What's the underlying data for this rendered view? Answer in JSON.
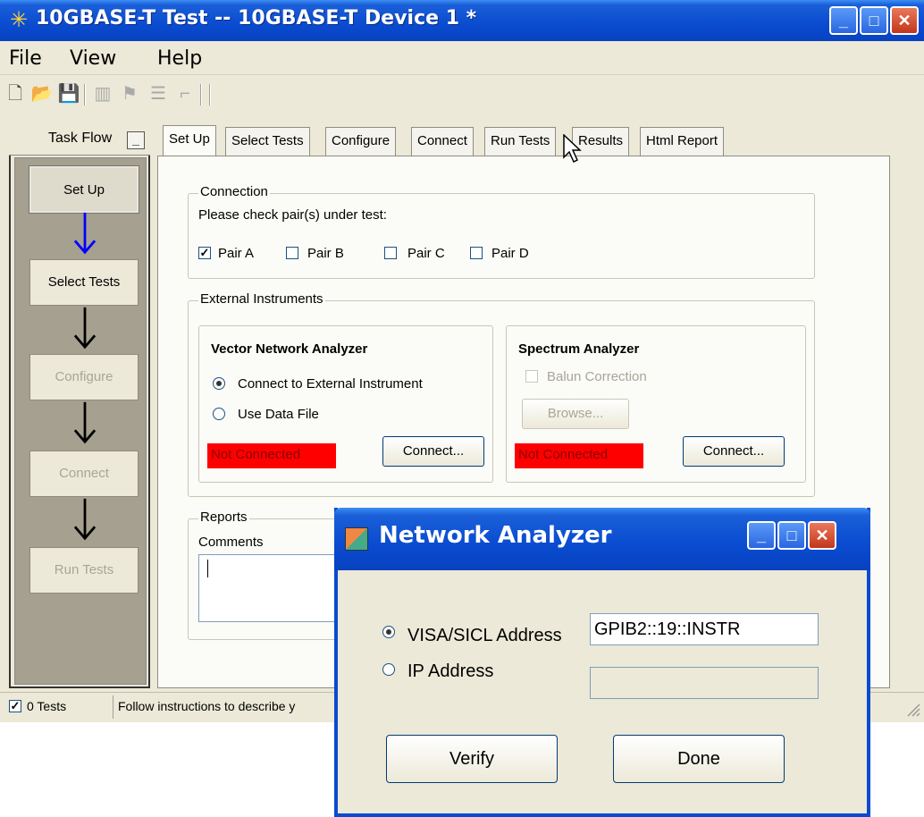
{
  "window": {
    "title": "10GBASE-T Test -- 10GBASE-T Device 1 *"
  },
  "menu": [
    "File",
    "View",
    "Help"
  ],
  "toolbar_icons": [
    "new-file-icon",
    "open-folder-icon",
    "save-icon",
    "chart-icon",
    "flag-icon",
    "list-icon",
    "bracket-icon"
  ],
  "task_flow": {
    "title": "Task Flow",
    "steps": [
      {
        "label": "Set Up",
        "state": "active"
      },
      {
        "label": "Select Tests",
        "state": "enabled"
      },
      {
        "label": "Configure",
        "state": "disabled"
      },
      {
        "label": "Connect",
        "state": "disabled"
      },
      {
        "label": "Run Tests",
        "state": "disabled"
      }
    ]
  },
  "tabs": [
    "Set Up",
    "Select Tests",
    "Configure",
    "Connect",
    "Run Tests",
    "Results",
    "Html Report"
  ],
  "connection": {
    "legend": "Connection",
    "prompt": "Please check pair(s) under test:",
    "pairs": [
      {
        "label": "Pair A",
        "checked": true
      },
      {
        "label": "Pair B",
        "checked": false
      },
      {
        "label": "Pair C",
        "checked": false
      },
      {
        "label": "Pair D",
        "checked": false
      }
    ]
  },
  "external": {
    "legend": "External Instruments",
    "vna": {
      "title": "Vector Network Analyzer",
      "option1": "Connect to External Instrument",
      "option2": "Use Data File",
      "status": "Not Connected",
      "connect": "Connect..."
    },
    "spectrum": {
      "title": "Spectrum Analyzer",
      "balun": "Balun Correction",
      "browse": "Browse...",
      "status": "Not Connected",
      "connect": "Connect..."
    }
  },
  "reports": {
    "legend": "Reports",
    "comments": "Comments"
  },
  "status_bar": {
    "tests": "0 Tests",
    "message": "Follow instructions to describe y"
  },
  "dialog": {
    "title": "Network Analyzer",
    "visa_label": "VISA/SICL Address",
    "visa_value": "GPIB2::19::INSTR",
    "ip_label": "IP Address",
    "ip_value": "",
    "verify": "Verify",
    "done": "Done"
  },
  "colors": {
    "title_blue": "#0a4bd0",
    "not_connected": "#ff0000",
    "arrow_blue": "#0000ff"
  }
}
